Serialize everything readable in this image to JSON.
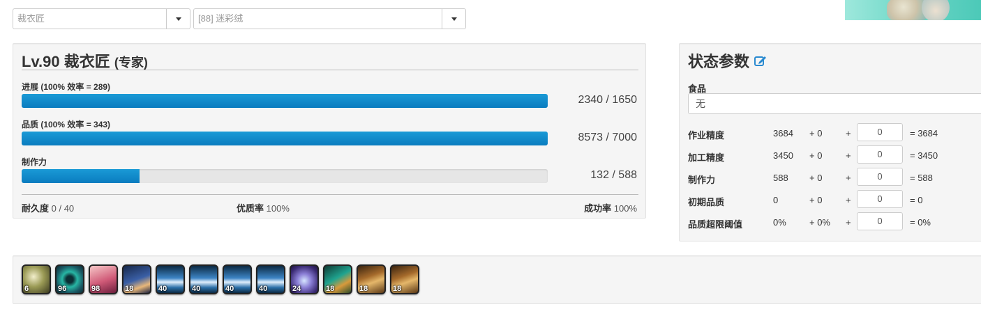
{
  "selectors": {
    "job": "裁衣匠",
    "recipe": "[88] 迷彩绒"
  },
  "craft": {
    "title_main": "Lv.90 裁衣匠",
    "title_sub": "(专家)",
    "progress": {
      "label": "进展 (100% 效率 = 289)",
      "value": "2340 / 1650",
      "fill_pct": 100
    },
    "quality": {
      "label": "品质  (100% 效率 = 343)",
      "value": "8573 / 7000",
      "fill_pct": 100
    },
    "cp": {
      "label": "制作力",
      "value": "132 / 588",
      "fill_pct": 22.4
    },
    "durability_label": "耐久度",
    "durability_value": "0 / 40",
    "hq_label": "优质率",
    "hq_value": "100%",
    "success_label": "成功率",
    "success_value": "100%"
  },
  "stats": {
    "title": "状态参数",
    "food_label": "食品",
    "food_value": "无",
    "rows": [
      {
        "name": "作业精度",
        "base": "3684",
        "bonus": "+ 0",
        "plus": "+",
        "input": "0",
        "total": "= 3684"
      },
      {
        "name": "加工精度",
        "base": "3450",
        "bonus": "+ 0",
        "plus": "+",
        "input": "0",
        "total": "= 3450"
      },
      {
        "name": "制作力",
        "base": "588",
        "bonus": "+ 0",
        "plus": "+",
        "input": "0",
        "total": "= 588"
      },
      {
        "name": "初期品质",
        "base": "0",
        "bonus": "+ 0",
        "plus": "+",
        "input": "0",
        "total": "= 0"
      },
      {
        "name": "品质超限阈值",
        "base": "0%",
        "bonus": "+ 0%",
        "plus": "+",
        "input": "0",
        "total": "= 0%"
      }
    ]
  },
  "actions": [
    {
      "icon": "muscle-memory-icon",
      "count": "6"
    },
    {
      "icon": "manipulation-icon",
      "count": "96"
    },
    {
      "icon": "veneration-icon",
      "count": "98"
    },
    {
      "icon": "waste-not-icon",
      "count": "18"
    },
    {
      "icon": "groundwork-icon",
      "count": "40"
    },
    {
      "icon": "groundwork-icon",
      "count": "40"
    },
    {
      "icon": "groundwork-icon",
      "count": "40"
    },
    {
      "icon": "groundwork-icon",
      "count": "40"
    },
    {
      "icon": "innovation-icon",
      "count": "24"
    },
    {
      "icon": "preparatory-touch-icon",
      "count": "18"
    },
    {
      "icon": "basic-touch-icon",
      "count": "18"
    },
    {
      "icon": "basic-touch-icon",
      "count": "18"
    }
  ]
}
